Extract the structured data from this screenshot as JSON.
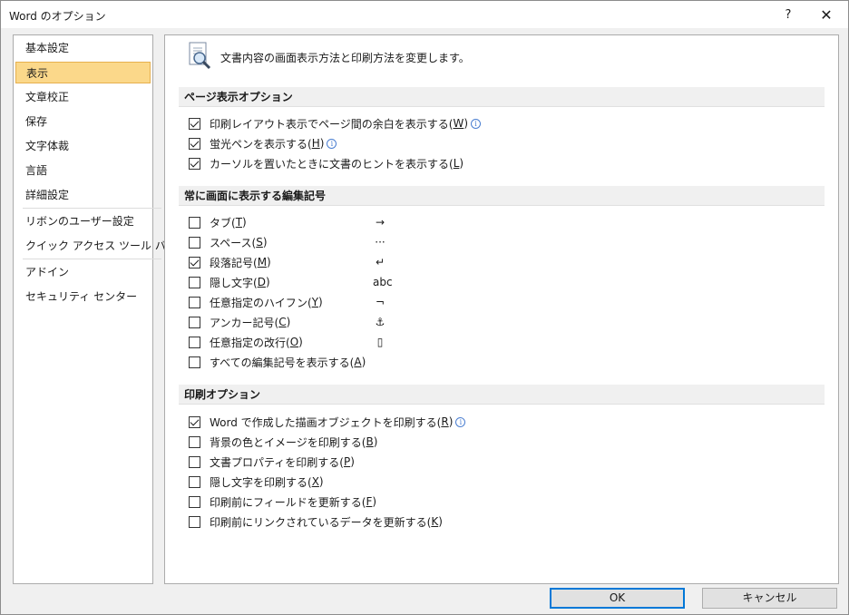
{
  "window": {
    "title": "Word のオプション",
    "help": "?",
    "close": "✕"
  },
  "sidebar": {
    "items": [
      {
        "label": "基本設定"
      },
      {
        "label": "表示"
      },
      {
        "label": "文章校正"
      },
      {
        "label": "保存"
      },
      {
        "label": "文字体裁"
      },
      {
        "label": "言語"
      },
      {
        "label": "詳細設定"
      },
      {
        "label": "リボンのユーザー設定"
      },
      {
        "label": "クイック アクセス ツール バー"
      },
      {
        "label": "アドイン"
      },
      {
        "label": "セキュリティ センター"
      }
    ]
  },
  "intro": {
    "text": "文書内容の画面表示方法と印刷方法を変更します。"
  },
  "sections": {
    "page": {
      "title": "ページ表示オプション",
      "options": [
        {
          "text": "印刷レイアウト表示でページ間の余白を表示する(",
          "key": "W",
          "end": ")",
          "checked": true,
          "info": true
        },
        {
          "text": "蛍光ペンを表示する(",
          "key": "H",
          "end": ")",
          "checked": true,
          "info": true
        },
        {
          "text": "カーソルを置いたときに文書のヒントを表示する(",
          "key": "L",
          "end": ")",
          "checked": true,
          "info": false
        }
      ]
    },
    "marks": {
      "title": "常に画面に表示する編集記号",
      "options": [
        {
          "text": "タブ(",
          "key": "T",
          "end": ")",
          "checked": false,
          "symbol": "→"
        },
        {
          "text": "スペース(",
          "key": "S",
          "end": ")",
          "checked": false,
          "symbol": "···"
        },
        {
          "text": "段落記号(",
          "key": "M",
          "end": ")",
          "checked": true,
          "symbol": "↵"
        },
        {
          "text": "隠し文字(",
          "key": "D",
          "end": ")",
          "checked": false,
          "symbol": "abc"
        },
        {
          "text": "任意指定のハイフン(",
          "key": "Y",
          "end": ")",
          "checked": false,
          "symbol": "¬"
        },
        {
          "text": "アンカー記号(",
          "key": "C",
          "end": ")",
          "checked": false,
          "symbol": "⚓"
        },
        {
          "text": "任意指定の改行(",
          "key": "O",
          "end": ")",
          "checked": false,
          "symbol": "▯"
        },
        {
          "text": "すべての編集記号を表示する(",
          "key": "A",
          "end": ")",
          "checked": false,
          "symbol": ""
        }
      ]
    },
    "print": {
      "title": "印刷オプション",
      "options": [
        {
          "text": "Word で作成した描画オブジェクトを印刷する(",
          "key": "R",
          "end": ")",
          "checked": true,
          "info": true
        },
        {
          "text": "背景の色とイメージを印刷する(",
          "key": "B",
          "end": ")",
          "checked": false,
          "info": false
        },
        {
          "text": "文書プロパティを印刷する(",
          "key": "P",
          "end": ")",
          "checked": false,
          "info": false
        },
        {
          "text": "隠し文字を印刷する(",
          "key": "X",
          "end": ")",
          "checked": false,
          "info": false
        },
        {
          "text": "印刷前にフィールドを更新する(",
          "key": "F",
          "end": ")",
          "checked": false,
          "info": false
        },
        {
          "text": "印刷前にリンクされているデータを更新する(",
          "key": "K",
          "end": ")",
          "checked": false,
          "info": false
        }
      ]
    }
  },
  "buttons": {
    "ok": "OK",
    "cancel": "キャンセル"
  },
  "colors": {
    "selected_bg": "#fbd88a",
    "selected_border": "#e6b04e",
    "ok_border": "#0078d7"
  }
}
